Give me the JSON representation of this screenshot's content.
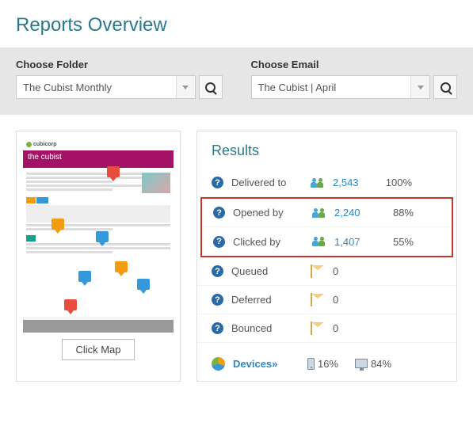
{
  "title": "Reports Overview",
  "filters": {
    "folder": {
      "label": "Choose Folder",
      "value": "The Cubist Monthly"
    },
    "email": {
      "label": "Choose Email",
      "value": "The Cubist | April"
    }
  },
  "preview": {
    "brand": "cubicorp",
    "banner": "the cubist",
    "click_map_label": "Click Map"
  },
  "results": {
    "heading": "Results",
    "rows": [
      {
        "label": "Delivered to",
        "value": "2,543",
        "pct": "100%",
        "icon": "people"
      },
      {
        "label": "Opened by",
        "value": "2,240",
        "pct": "88%",
        "icon": "people"
      },
      {
        "label": "Clicked by",
        "value": "1,407",
        "pct": "55%",
        "icon": "people"
      },
      {
        "label": "Queued",
        "value": "0",
        "pct": "",
        "icon": "envelope"
      },
      {
        "label": "Deferred",
        "value": "0",
        "pct": "",
        "icon": "envelope"
      },
      {
        "label": "Bounced",
        "value": "0",
        "pct": "",
        "icon": "envelope"
      }
    ],
    "devices": {
      "label": "Devices»",
      "mobile_pct": "16%",
      "desktop_pct": "84%"
    }
  }
}
